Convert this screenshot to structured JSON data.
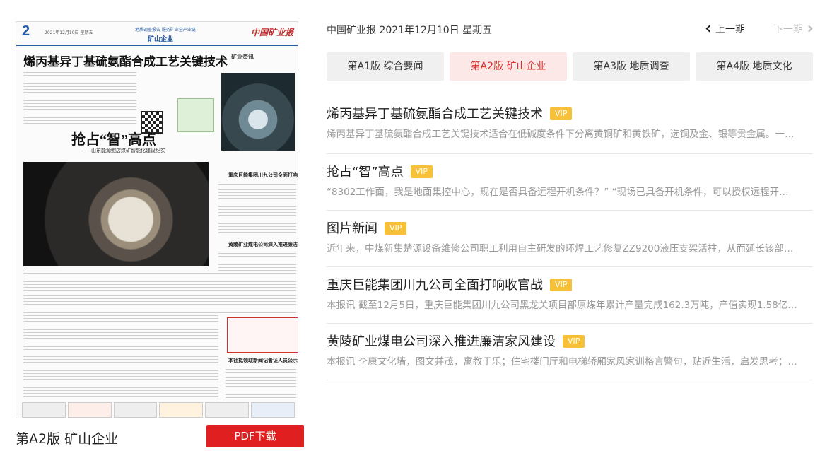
{
  "header": {
    "date_line": "中国矿业报 2021年12月10日 星期五",
    "prev_label": "上一期",
    "next_label": "下一期"
  },
  "tabs": [
    {
      "label": "第A1版 综合要闻",
      "active": false
    },
    {
      "label": "第A2版 矿山企业",
      "active": true
    },
    {
      "label": "第A3版 地质调查",
      "active": false
    },
    {
      "label": "第A4版 地质文化",
      "active": false
    }
  ],
  "articles": [
    {
      "title": "烯丙基异丁基硫氨酯合成工艺关键技术",
      "badge": "VIP",
      "summary": "烯丙基异丁基硫氨酯合成工艺关键技术适合在低碱度条件下分离黄铜矿和黄铁矿，选铜及金、银等贵金属。一…"
    },
    {
      "title": "抢占“智”高点",
      "badge": "VIP",
      "summary": "“8302工作面，我是地面集控中心，现在是否具备远程开机条件？” “现场已具备开机条件，可以授权远程开…"
    },
    {
      "title": "图片新闻",
      "badge": "VIP",
      "summary": "近年来，中煤新集楚源设备维修公司职工利用自主研发的环焊工艺修复ZZ9200液压支架活柱，从而延长该部…"
    },
    {
      "title": "重庆巨能集团川九公司全面打响收官战",
      "badge": "VIP",
      "summary": "本报讯 截至12月5日，重庆巨能集团川九公司黑龙关项目部原煤年累计产量完成162.3万吨，产值实现1.58亿…"
    },
    {
      "title": "黄陵矿业煤电公司深入推进廉洁家风建设",
      "badge": "VIP",
      "summary": "本报讯 李康文化墙，图文并茂，寓教于乐；住宅楼门厅和电梯轿厢家风家训格言警句，贴近生活，启发思考；…"
    }
  ],
  "paper": {
    "page_no": "2",
    "date": "2021年12月10日 星期五",
    "slogan": "地质调查报告 服务矿业全产业链",
    "section": "矿山企业",
    "masthead": "中国矿业报",
    "headline_1": "烯丙基异丁基硫氨酯合成工艺关键技术",
    "headline_2": "抢占“智”高点",
    "subhead_2": "——山东能源鲍店煤矿智能化建设纪实",
    "tag": "矿业资讯",
    "box_title_1": "重庆巨能集团川九公司全面打响收官战",
    "box_title_2": "黄陵矿业煤电公司深入推进廉洁家风建设",
    "box_title_3": "本社拟领取新闻记者证人员公示"
  },
  "footer": {
    "edition_caption": "第A2版 矿山企业",
    "pdf_label": "PDF下载"
  },
  "colors": {
    "accent": "#e02020",
    "vip": "#f6c038",
    "tab_active_bg": "#fde8e8"
  }
}
